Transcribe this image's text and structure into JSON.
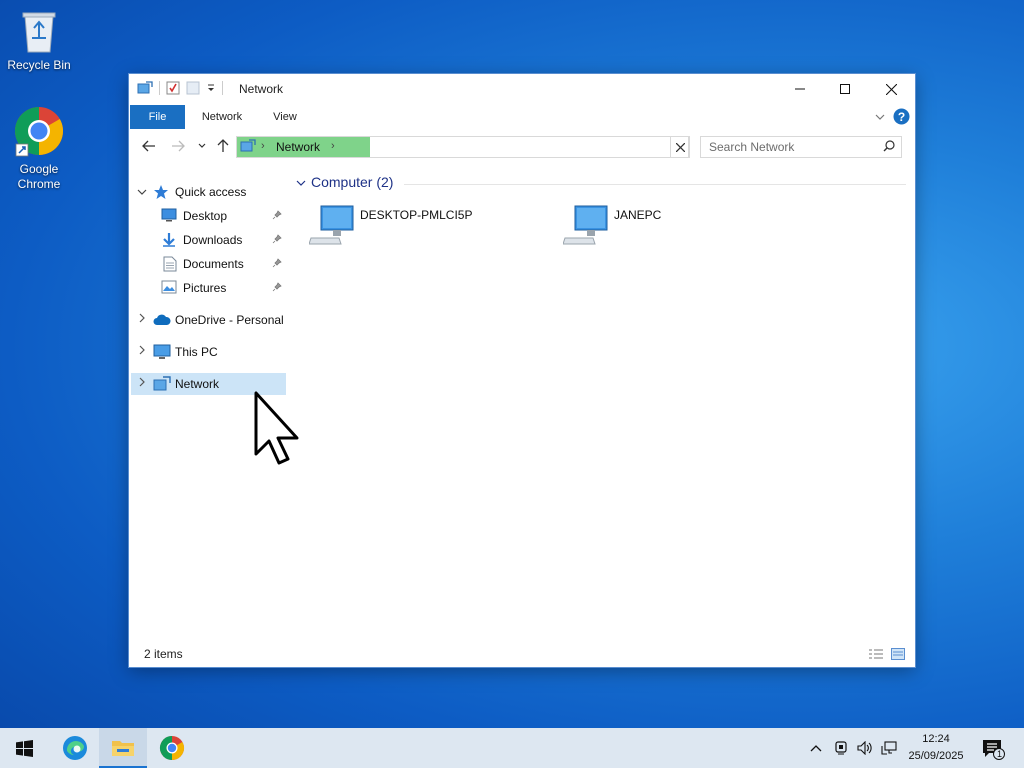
{
  "desktop": {
    "icons": [
      {
        "label": "Recycle Bin",
        "icon": "recycle-bin-icon"
      },
      {
        "label": "Google Chrome",
        "icon": "chrome-icon"
      }
    ]
  },
  "window": {
    "title": "Network",
    "ribbon_tabs": [
      "File",
      "Network",
      "View"
    ],
    "address": {
      "root_icon": "network-icon",
      "crumb": "Network"
    },
    "search_placeholder": "Search Network",
    "nav_pane": {
      "quick_access": "Quick access",
      "quick_items": [
        "Desktop",
        "Downloads",
        "Documents",
        "Pictures"
      ],
      "onedrive": "OneDrive - Personal",
      "this_pc": "This PC",
      "network": "Network"
    },
    "group_title": "Computer (2)",
    "computers": [
      "DESKTOP-PMLCI5P",
      "JANEPC"
    ],
    "status": "2 items"
  },
  "taskbar": {
    "apps": [
      "start-icon",
      "edge-icon",
      "file-explorer-icon",
      "chrome-icon"
    ],
    "time": "12:24",
    "date": "25/09/2025",
    "notification_count": "1"
  },
  "colors": {
    "file_tab": "#1a6fc2",
    "address_highlight": "#7fd38a",
    "selection": "#cce4f7",
    "group_title": "#1e3287"
  }
}
